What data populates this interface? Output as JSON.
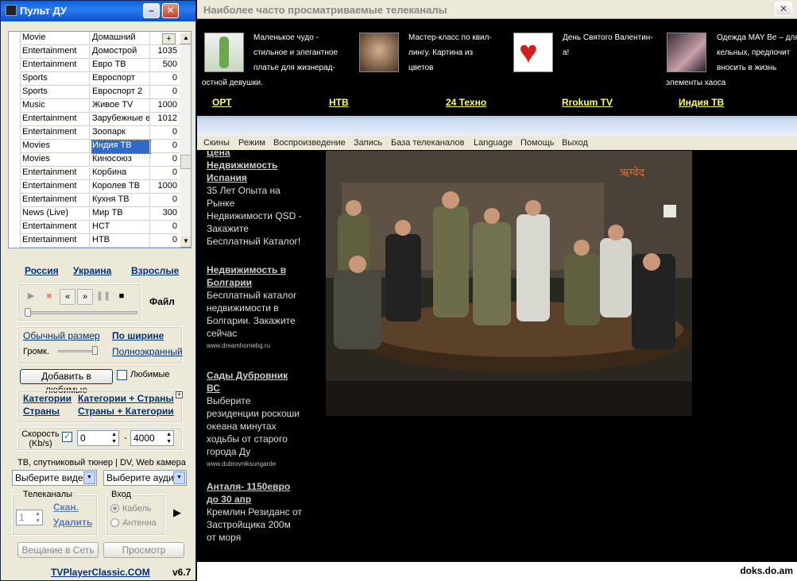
{
  "left": {
    "title": "Пульт ДУ",
    "channels": [
      {
        "cat": "Movie",
        "name": "Домашний",
        "val": ""
      },
      {
        "cat": "Entertainment",
        "name": "Домострой",
        "val": "1035"
      },
      {
        "cat": "Entertainment",
        "name": "Евро ТВ",
        "val": "500"
      },
      {
        "cat": "Sports",
        "name": "Евроспорт",
        "val": "0"
      },
      {
        "cat": "Sports",
        "name": "Евроспорт 2",
        "val": "0"
      },
      {
        "cat": "Music",
        "name": "Живое TV",
        "val": "1000"
      },
      {
        "cat": "Entertainment",
        "name": "Зарубежные е",
        "val": "1012"
      },
      {
        "cat": "Entertainment",
        "name": "Зоопарк",
        "val": "0"
      },
      {
        "cat": "Movies",
        "name": "Индия ТВ",
        "val": "0"
      },
      {
        "cat": "Movies",
        "name": "Киносоюз",
        "val": "0"
      },
      {
        "cat": "Entertainment",
        "name": "Корбина",
        "val": "0"
      },
      {
        "cat": "Entertainment",
        "name": "Королев ТВ",
        "val": "1000"
      },
      {
        "cat": "Entertainment",
        "name": "Кухня ТВ",
        "val": "0"
      },
      {
        "cat": "News (Live)",
        "name": "Мир ТВ",
        "val": "300"
      },
      {
        "cat": "Entertainment",
        "name": "НСТ",
        "val": "0"
      },
      {
        "cat": "Entertainment",
        "name": "НТВ",
        "val": "0"
      }
    ],
    "regions": {
      "russia": "Россия",
      "ukraine": "Украина",
      "adult": "Взрослые"
    },
    "file_label": "Файл",
    "normal_size": "Обычный размер",
    "fit_width": "По ширине",
    "volume": "Громк.",
    "fullscreen": "Полноэкранный",
    "add_fav": "Добавить в любимые",
    "favorites": "Любимые",
    "categories": "Категории",
    "cat_countries": "Категории + Страны",
    "countries": "Страны",
    "countries_cat": "Страны + Категории",
    "speed_label": "Скорость (Kb/s)",
    "speed_from": "0",
    "speed_to": "4000",
    "tuner_label": "ТВ, спутниковый тюнер | DV, Web камера",
    "video_select": "Выберите видео",
    "audio_select": "Выберите аудио",
    "tv_channels": "Телеканалы",
    "channel_count": "1",
    "scan": "Скан.",
    "delete": "Удалить",
    "input": "Вход",
    "cable": "Кабель",
    "antenna": "Антенна",
    "broadcast": "Вещание в Сеть",
    "preview": "Просмотр",
    "site": "TVPlayerClassic.COM",
    "version": "v6.7"
  },
  "top": {
    "title": "Наиболее часто просматриваемые телеканалы",
    "items": [
      {
        "l1": "Маленькое чудо -",
        "l2": "стильное и элегантное",
        "l3": "платье для жизнерад-",
        "l4": "остной девушки."
      },
      {
        "l1": "Мастер-класс по квил-",
        "l2": "лингу. Картина из",
        "l3": "цветов",
        "l4": ""
      },
      {
        "l1": "День Святого Валентин-",
        "l2": "а!",
        "l3": "",
        "l4": ""
      },
      {
        "l1": "Одежда MAY Be – для",
        "l2": "кельных, предпочит",
        "l3": "вносить в жизнь",
        "l4": "элементы хаоса"
      }
    ],
    "channels": [
      "ОРТ",
      "НТВ",
      "24 Техно",
      "Rrokum TV",
      "Индия ТВ"
    ]
  },
  "main": {
    "menu": [
      "Скины",
      "Режим",
      "Воспроизведение",
      "Запись",
      "База телеканалов",
      "Language",
      "Помощь",
      "Выход"
    ],
    "ads": [
      {
        "h": "Цена Недвижимость Испания",
        "t": "35 Лет Опыта на Рынке Недвижимости QSD - Закажите Бесплатный Каталог!",
        "u": ""
      },
      {
        "h": "Недвижимость в Болгарии",
        "t": "Бесплатный каталог недвижимости в Болгарии. Закажите сейчас",
        "u": "www.dreamhomebg.ru"
      },
      {
        "h": "Сады Дубровник ВС",
        "t": "Выберите резиденции роскоши океана минутах ходьбы от старого города Ду",
        "u": "www.dubrovniksungarde"
      },
      {
        "h": "Анталя- 1150евро до 30 апр",
        "t": "Кремлин Резиданс от Застройщика 200м от моря",
        "u": ""
      }
    ],
    "watermark": "doks.do.am"
  }
}
